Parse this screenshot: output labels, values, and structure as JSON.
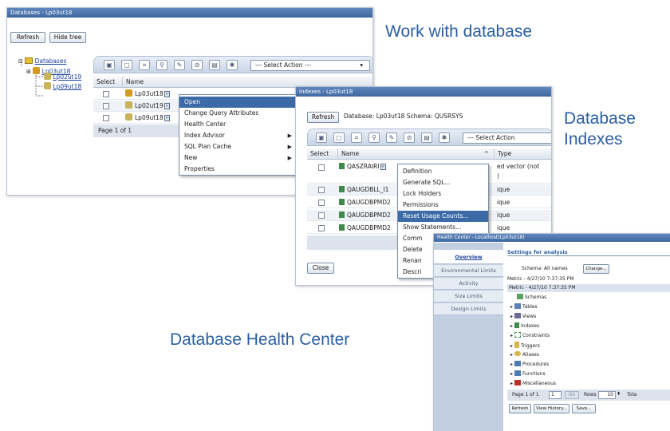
{
  "callouts": {
    "work_with_database": "Work with database",
    "database_indexes_1": "Database",
    "database_indexes_2": "Indexes",
    "health_center": "Database Health Center"
  },
  "databases_window": {
    "title": "Databases - Lp03ut18",
    "refresh_label": "Refresh",
    "hide_tree_label": "Hide tree",
    "tree": {
      "root": "Databases",
      "children": [
        "Lp03ut18",
        "Lp02ut19",
        "Lp09ut18"
      ]
    },
    "select_action": "--- Select Action ---",
    "columns": {
      "select": "Select",
      "name": "Name"
    },
    "rows": [
      "Lp03ut18",
      "Lp02ut19",
      "Lp09ut18"
    ],
    "pagination": "Page 1 of 1",
    "context_menu": [
      {
        "label": "Open",
        "selected": true,
        "submenu": false
      },
      {
        "label": "Change Query Attributes",
        "selected": false,
        "submenu": false
      },
      {
        "label": "Health Center",
        "selected": false,
        "submenu": false
      },
      {
        "label": "Index Advisor",
        "selected": false,
        "submenu": true
      },
      {
        "label": "SQL Plan Cache",
        "selected": false,
        "submenu": true
      },
      {
        "label": "New",
        "selected": false,
        "submenu": true
      },
      {
        "label": "Properties",
        "selected": false,
        "submenu": false
      }
    ]
  },
  "indexes_window": {
    "title": "Indexes - Lp03ut18",
    "refresh_label": "Refresh",
    "info": "Database: Lp03ut18  Schema: QUSRSYS",
    "select_action": "--- Select Action",
    "columns": {
      "select": "Select",
      "name": "Name",
      "type": "Type"
    },
    "rows": [
      {
        "name": "QASZRAIRI",
        "type": "ed vector (not"
      },
      {
        "name": "QAUGDBLL_I1",
        "type": "ique"
      },
      {
        "name": "QAUGDBPMD2",
        "type": "ique"
      },
      {
        "name": "QAUGDBPMD2",
        "type": "ique"
      },
      {
        "name": "QAUGDBPMD2",
        "type": "ique"
      }
    ],
    "type_extra": ")",
    "close_label": "Close",
    "context_menu": [
      {
        "label": "Definition",
        "selected": false
      },
      {
        "label": "Generate SQL...",
        "selected": false
      },
      {
        "label": "Lock Holders",
        "selected": false
      },
      {
        "label": "Permissions",
        "selected": false
      },
      {
        "label": "Reset Usage Counts...",
        "selected": true
      },
      {
        "label": "Show Statements...",
        "selected": false
      },
      {
        "label": "Comm",
        "selected": false
      },
      {
        "label": "Delete",
        "selected": false
      },
      {
        "label": "Renan",
        "selected": false
      },
      {
        "label": "Descri",
        "selected": false
      }
    ]
  },
  "health_window": {
    "title": "Health Center - Localhost(Lp03ut18)",
    "tabs": [
      "Overview",
      "Environmental Limits",
      "Activity",
      "Size Limits",
      "Design Limits"
    ],
    "settings_heading": "Settings for analysis",
    "schema_text": "Schema: All names",
    "change_label": "Change...",
    "metric_line1": "Metric - 4/27/10 7:37:35 PM",
    "metric_line2": "Metric - 4/27/10 7:37:35 PM",
    "items": [
      "Schemas",
      "Tables",
      "Views",
      "Indexes",
      "Constraints",
      "Triggers",
      "Aliases",
      "Procedures",
      "Functions",
      "Miscellaneous"
    ],
    "pagination": "Page 1 of 1",
    "page_input": "1",
    "go_label": "Go",
    "rows_label": "Rows",
    "rows_value": "10",
    "total_label": "Tota",
    "refresh_label": "Refresh",
    "view_history_label": "View History...",
    "save_label": "Save..."
  }
}
